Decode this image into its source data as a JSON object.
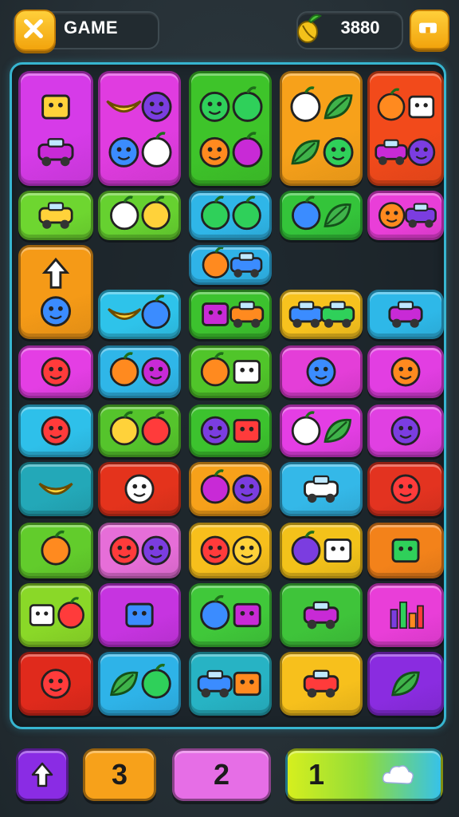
{
  "header": {
    "title": "GAME",
    "score": "3880",
    "colors": {
      "button": "#f5b316",
      "panel": "#222b30"
    }
  },
  "board": {
    "border_color": "#37b5d0",
    "tiles": [
      {
        "name": "tile-flag-text",
        "color": "#d63be8",
        "icons": [
          "flag-icon",
          "text-card-icon"
        ]
      },
      {
        "name": "tile-banana-face",
        "color": "#e03ce0",
        "icons": [
          "banana-icon",
          "purple-blob-icon",
          "smiley-icon",
          "plum-icon"
        ]
      },
      {
        "name": "tile-creatures",
        "color": "#3ec42a",
        "icons": [
          "red-creature-icon",
          "egg-icon",
          "purple-blob-icon",
          "skull-icon"
        ]
      },
      {
        "name": "tile-fruits",
        "color": "#f7a11a",
        "icons": [
          "apple-icon",
          "leaf-icon",
          "leaf-icon",
          "sun-face-icon"
        ]
      },
      {
        "name": "tile-apple-cart",
        "color": "#f24a1b",
        "icons": [
          "green-apple-icon",
          "note-icon",
          "cart-icon",
          "smiley-icon"
        ]
      },
      {
        "name": "tile-toy-car",
        "color": "#6ed630",
        "icons": [
          "toy-car-icon"
        ]
      },
      {
        "name": "tile-strawberry-bunny",
        "color": "#66d130",
        "icons": [
          "strawberry-icon",
          "bunny-icon"
        ]
      },
      {
        "name": "tile-pumpkin",
        "color": "#2fb6e8",
        "icons": [
          "pumpkin-icon",
          "orange-icon"
        ]
      },
      {
        "name": "tile-pineapple",
        "color": "#34c43a",
        "icons": [
          "pineapple-icon",
          "leaf-icon"
        ]
      },
      {
        "name": "tile-face-car",
        "color": "#e93ed8",
        "icons": [
          "smiley-icon",
          "car-icon"
        ]
      },
      {
        "name": "tile-arrow-face",
        "color": "#f59a17",
        "icons": [
          "up-arrow-icon",
          "smiley-icon"
        ]
      },
      {
        "name": "tile-purple-truck",
        "color": "#2fb3e8",
        "icons": [
          "purple-fruit-icon",
          "truck-icon"
        ]
      },
      {
        "name": "tile-banana-star",
        "color": "#2ec3ea",
        "icons": [
          "banana-icon",
          "star-icon"
        ]
      },
      {
        "name": "tile-block-truck",
        "color": "#3cc22e",
        "icons": [
          "block-icon",
          "red-truck-icon"
        ]
      },
      {
        "name": "tile-cars",
        "color": "#f7c21e",
        "icons": [
          "car-icon",
          "red-car-icon"
        ]
      },
      {
        "name": "tile-blue-car",
        "color": "#2eb8e8",
        "icons": [
          "van-icon"
        ]
      },
      {
        "name": "tile-cat",
        "color": "#e43ee4",
        "icons": [
          "cat-icon"
        ]
      },
      {
        "name": "tile-pepper-sun",
        "color": "#2fb6e8",
        "icons": [
          "pepper-icon",
          "sun-face-icon"
        ]
      },
      {
        "name": "tile-lemon-chat",
        "color": "#50c52a",
        "icons": [
          "lemon-icon",
          "chat-icon"
        ]
      },
      {
        "name": "tile-spider",
        "color": "#e43ed8",
        "icons": [
          "spider-icon"
        ]
      },
      {
        "name": "tile-fox",
        "color": "#e23ee2",
        "icons": [
          "fox-icon"
        ]
      },
      {
        "name": "tile-smiley",
        "color": "#2ec0ea",
        "icons": [
          "smiley-icon"
        ]
      },
      {
        "name": "tile-tomato-ball",
        "color": "#55c42c",
        "icons": [
          "tomato-icon",
          "ball-icon"
        ]
      },
      {
        "name": "tile-face-box",
        "color": "#3cc22e",
        "icons": [
          "smiley-icon",
          "box-icon"
        ]
      },
      {
        "name": "tile-c-leaf",
        "color": "#e43ee4",
        "icons": [
          "c-letter-icon",
          "leaf-icon"
        ]
      },
      {
        "name": "tile-frog",
        "color": "#e040e2",
        "icons": [
          "frog-icon"
        ]
      },
      {
        "name": "tile-banana",
        "color": "#23a8b8",
        "icons": [
          "banana-icon"
        ]
      },
      {
        "name": "tile-robot",
        "color": "#e4331c",
        "icons": [
          "robot-icon"
        ]
      },
      {
        "name": "tile-tomatoes",
        "color": "#f7a11a",
        "icons": [
          "tomato-icon",
          "sun-face-icon"
        ]
      },
      {
        "name": "tile-bus",
        "color": "#34b8e8",
        "icons": [
          "bus-icon"
        ]
      },
      {
        "name": "tile-ghost",
        "color": "#e33320",
        "icons": [
          "ghost-icon"
        ]
      },
      {
        "name": "tile-lollipop",
        "color": "#62cc2c",
        "icons": [
          "lollipop-icon"
        ]
      },
      {
        "name": "tile-masks",
        "color": "#e66ed8",
        "icons": [
          "orange-face-icon",
          "mask-icon"
        ]
      },
      {
        "name": "tile-faces",
        "color": "#f7bf1c",
        "icons": [
          "grape-face-icon",
          "mango-face-icon"
        ]
      },
      {
        "name": "tile-apple-chat",
        "color": "#f3c21a",
        "icons": [
          "green-apple-icon",
          "chat-icon"
        ]
      },
      {
        "name": "tile-bag",
        "color": "#f3821a",
        "icons": [
          "bag-icon"
        ]
      },
      {
        "name": "tile-music",
        "color": "#8ad828",
        "icons": [
          "music-note-icon",
          "cherry-icon"
        ]
      },
      {
        "name": "tile-dice",
        "color": "#c634e0",
        "icons": [
          "dice-icon"
        ]
      },
      {
        "name": "tile-bee-box",
        "color": "#40c83a",
        "icons": [
          "bee-icon",
          "box-icon"
        ]
      },
      {
        "name": "tile-van",
        "color": "#3fc43a",
        "icons": [
          "van-icon"
        ]
      },
      {
        "name": "tile-chart",
        "color": "#e93ed8",
        "icons": [
          "bar-chart-icon"
        ]
      },
      {
        "name": "tile-sun",
        "color": "#e02a1c",
        "icons": [
          "spiky-face-icon"
        ]
      },
      {
        "name": "tile-leaf-apple",
        "color": "#2eb3e8",
        "icons": [
          "leaf-icon",
          "bell-pepper-icon"
        ]
      },
      {
        "name": "tile-carrot-can",
        "color": "#27b3c4",
        "icons": [
          "carrot-icon",
          "can-icon"
        ]
      },
      {
        "name": "tile-toy",
        "color": "#f7c01c",
        "icons": [
          "toy-car-icon"
        ]
      },
      {
        "name": "tile-spinach",
        "color": "#8a2ce0",
        "icons": [
          "leaf-icon"
        ]
      }
    ]
  },
  "footer": {
    "buttons": [
      {
        "name": "up-arrow-button",
        "label": "",
        "icon": "up-arrow-icon",
        "color": "#8a2ce4"
      },
      {
        "name": "counter-3-button",
        "label": "3",
        "icon": "",
        "color": "#f7a11a"
      },
      {
        "name": "counter-2-button",
        "label": "2",
        "icon": "",
        "color": "#e66ee6"
      },
      {
        "name": "counter-1-button",
        "label": "1",
        "icon": "cloud-icon",
        "color": "#b4ea1e"
      }
    ]
  }
}
